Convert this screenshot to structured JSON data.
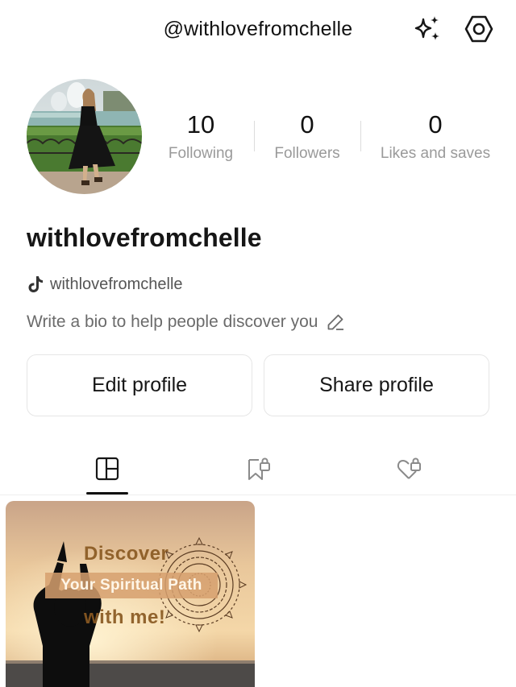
{
  "header": {
    "handle": "@withlovefromchelle",
    "icons": [
      "sparkles-icon",
      "settings-hexagon-icon"
    ]
  },
  "profile": {
    "avatar": "profile-photo",
    "display_name": "withlovefromchelle",
    "tiktok_handle": "withlovefromchelle",
    "bio_placeholder": "Write a bio to help people discover you"
  },
  "stats": {
    "following": {
      "value": "10",
      "label": "Following"
    },
    "followers": {
      "value": "0",
      "label": "Followers"
    },
    "likes": {
      "value": "0",
      "label": "Likes and saves"
    }
  },
  "actions": {
    "edit_label": "Edit profile",
    "share_label": "Share profile"
  },
  "tabs": [
    {
      "name": "posts-grid-icon",
      "active": true
    },
    {
      "name": "saved-locked-icon",
      "active": false
    },
    {
      "name": "liked-locked-icon",
      "active": false
    }
  ],
  "posts": [
    {
      "line1": "Discover",
      "line2": "Your Spiritual Path",
      "line3": "with me!"
    }
  ],
  "colors": {
    "text": "#161616",
    "muted": "#9a9a9a",
    "border": "#e6e6e6"
  }
}
